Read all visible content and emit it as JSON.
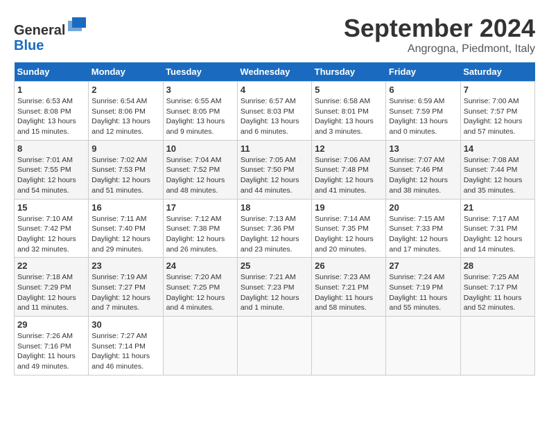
{
  "header": {
    "logo_line1": "General",
    "logo_line2": "Blue",
    "month": "September 2024",
    "location": "Angrogna, Piedmont, Italy"
  },
  "weekdays": [
    "Sunday",
    "Monday",
    "Tuesday",
    "Wednesday",
    "Thursday",
    "Friday",
    "Saturday"
  ],
  "weeks": [
    [
      {
        "day": "1",
        "info": "Sunrise: 6:53 AM\nSunset: 8:08 PM\nDaylight: 13 hours\nand 15 minutes."
      },
      {
        "day": "2",
        "info": "Sunrise: 6:54 AM\nSunset: 8:06 PM\nDaylight: 13 hours\nand 12 minutes."
      },
      {
        "day": "3",
        "info": "Sunrise: 6:55 AM\nSunset: 8:05 PM\nDaylight: 13 hours\nand 9 minutes."
      },
      {
        "day": "4",
        "info": "Sunrise: 6:57 AM\nSunset: 8:03 PM\nDaylight: 13 hours\nand 6 minutes."
      },
      {
        "day": "5",
        "info": "Sunrise: 6:58 AM\nSunset: 8:01 PM\nDaylight: 13 hours\nand 3 minutes."
      },
      {
        "day": "6",
        "info": "Sunrise: 6:59 AM\nSunset: 7:59 PM\nDaylight: 13 hours\nand 0 minutes."
      },
      {
        "day": "7",
        "info": "Sunrise: 7:00 AM\nSunset: 7:57 PM\nDaylight: 12 hours\nand 57 minutes."
      }
    ],
    [
      {
        "day": "8",
        "info": "Sunrise: 7:01 AM\nSunset: 7:55 PM\nDaylight: 12 hours\nand 54 minutes."
      },
      {
        "day": "9",
        "info": "Sunrise: 7:02 AM\nSunset: 7:53 PM\nDaylight: 12 hours\nand 51 minutes."
      },
      {
        "day": "10",
        "info": "Sunrise: 7:04 AM\nSunset: 7:52 PM\nDaylight: 12 hours\nand 48 minutes."
      },
      {
        "day": "11",
        "info": "Sunrise: 7:05 AM\nSunset: 7:50 PM\nDaylight: 12 hours\nand 44 minutes."
      },
      {
        "day": "12",
        "info": "Sunrise: 7:06 AM\nSunset: 7:48 PM\nDaylight: 12 hours\nand 41 minutes."
      },
      {
        "day": "13",
        "info": "Sunrise: 7:07 AM\nSunset: 7:46 PM\nDaylight: 12 hours\nand 38 minutes."
      },
      {
        "day": "14",
        "info": "Sunrise: 7:08 AM\nSunset: 7:44 PM\nDaylight: 12 hours\nand 35 minutes."
      }
    ],
    [
      {
        "day": "15",
        "info": "Sunrise: 7:10 AM\nSunset: 7:42 PM\nDaylight: 12 hours\nand 32 minutes."
      },
      {
        "day": "16",
        "info": "Sunrise: 7:11 AM\nSunset: 7:40 PM\nDaylight: 12 hours\nand 29 minutes."
      },
      {
        "day": "17",
        "info": "Sunrise: 7:12 AM\nSunset: 7:38 PM\nDaylight: 12 hours\nand 26 minutes."
      },
      {
        "day": "18",
        "info": "Sunrise: 7:13 AM\nSunset: 7:36 PM\nDaylight: 12 hours\nand 23 minutes."
      },
      {
        "day": "19",
        "info": "Sunrise: 7:14 AM\nSunset: 7:35 PM\nDaylight: 12 hours\nand 20 minutes."
      },
      {
        "day": "20",
        "info": "Sunrise: 7:15 AM\nSunset: 7:33 PM\nDaylight: 12 hours\nand 17 minutes."
      },
      {
        "day": "21",
        "info": "Sunrise: 7:17 AM\nSunset: 7:31 PM\nDaylight: 12 hours\nand 14 minutes."
      }
    ],
    [
      {
        "day": "22",
        "info": "Sunrise: 7:18 AM\nSunset: 7:29 PM\nDaylight: 12 hours\nand 11 minutes."
      },
      {
        "day": "23",
        "info": "Sunrise: 7:19 AM\nSunset: 7:27 PM\nDaylight: 12 hours\nand 7 minutes."
      },
      {
        "day": "24",
        "info": "Sunrise: 7:20 AM\nSunset: 7:25 PM\nDaylight: 12 hours\nand 4 minutes."
      },
      {
        "day": "25",
        "info": "Sunrise: 7:21 AM\nSunset: 7:23 PM\nDaylight: 12 hours\nand 1 minute."
      },
      {
        "day": "26",
        "info": "Sunrise: 7:23 AM\nSunset: 7:21 PM\nDaylight: 11 hours\nand 58 minutes."
      },
      {
        "day": "27",
        "info": "Sunrise: 7:24 AM\nSunset: 7:19 PM\nDaylight: 11 hours\nand 55 minutes."
      },
      {
        "day": "28",
        "info": "Sunrise: 7:25 AM\nSunset: 7:17 PM\nDaylight: 11 hours\nand 52 minutes."
      }
    ],
    [
      {
        "day": "29",
        "info": "Sunrise: 7:26 AM\nSunset: 7:16 PM\nDaylight: 11 hours\nand 49 minutes."
      },
      {
        "day": "30",
        "info": "Sunrise: 7:27 AM\nSunset: 7:14 PM\nDaylight: 11 hours\nand 46 minutes."
      },
      {
        "day": "",
        "info": ""
      },
      {
        "day": "",
        "info": ""
      },
      {
        "day": "",
        "info": ""
      },
      {
        "day": "",
        "info": ""
      },
      {
        "day": "",
        "info": ""
      }
    ]
  ]
}
